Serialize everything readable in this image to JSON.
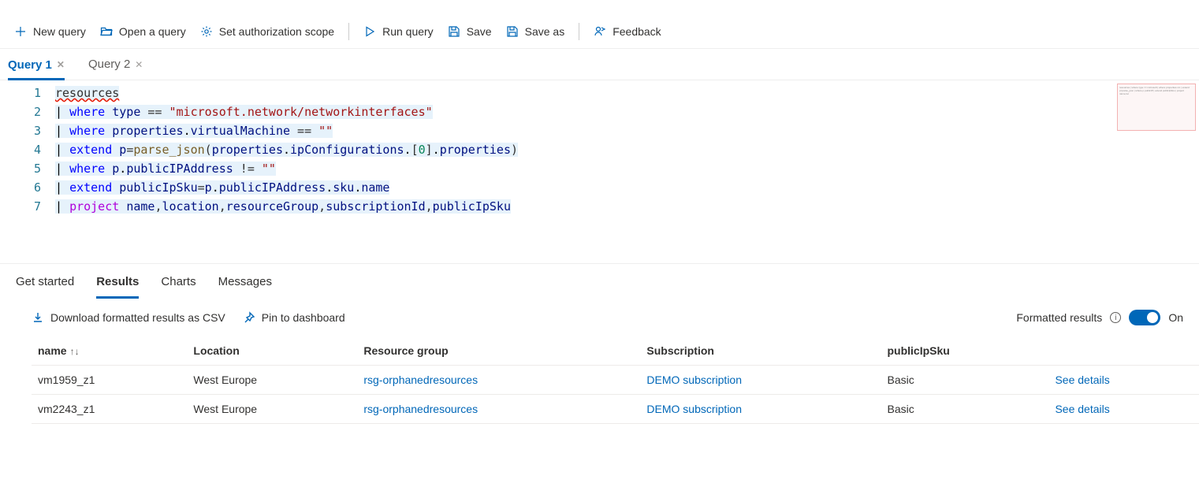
{
  "toolbar": {
    "new_query": "New query",
    "open_query": "Open a query",
    "auth_scope": "Set authorization scope",
    "run_query": "Run query",
    "save": "Save",
    "save_as": "Save as",
    "feedback": "Feedback"
  },
  "tabs": [
    {
      "label": "Query 1",
      "active": true
    },
    {
      "label": "Query 2",
      "active": false
    }
  ],
  "code": {
    "lines": [
      "1",
      "2",
      "3",
      "4",
      "5",
      "6",
      "7"
    ],
    "l1_resources": "resources",
    "pipe": "| ",
    "kw_where": "where",
    "kw_extend": "extend",
    "kw_project": "project",
    "id_type": "type",
    "eq": " == ",
    "neq": " != ",
    "str_nic": "\"microsoft.network/networkinterfaces\"",
    "id_properties": "properties",
    "id_virtualMachine": "virtualMachine",
    "str_empty": "\"\"",
    "id_p": "p",
    "fn_parse_json": "parse_json",
    "id_ipConfigurations": "ipConfigurations",
    "num_zero": "0",
    "id_publicIPAddress": "publicIPAddress",
    "id_publicIpSku": "publicIpSku",
    "id_sku": "sku",
    "id_name": "name",
    "id_location": "location",
    "id_resourceGroup": "resourceGroup",
    "id_subscriptionId": "subscriptionId"
  },
  "result_tabs": {
    "get_started": "Get started",
    "results": "Results",
    "charts": "Charts",
    "messages": "Messages"
  },
  "actions": {
    "download_csv": "Download formatted results as CSV",
    "pin_dashboard": "Pin to dashboard",
    "formatted_results": "Formatted results",
    "on": "On"
  },
  "table": {
    "headers": {
      "name": "name",
      "location": "Location",
      "rg": "Resource group",
      "sub": "Subscription",
      "sku": "publicIpSku",
      "details": ""
    },
    "rows": [
      {
        "name": "vm1959_z1",
        "location": "West Europe",
        "rg": "rsg-orphanedresources",
        "sub": "DEMO subscription",
        "sku": "Basic",
        "details": "See details"
      },
      {
        "name": "vm2243_z1",
        "location": "West Europe",
        "rg": "rsg-orphanedresources",
        "sub": "DEMO subscription",
        "sku": "Basic",
        "details": "See details"
      }
    ]
  }
}
